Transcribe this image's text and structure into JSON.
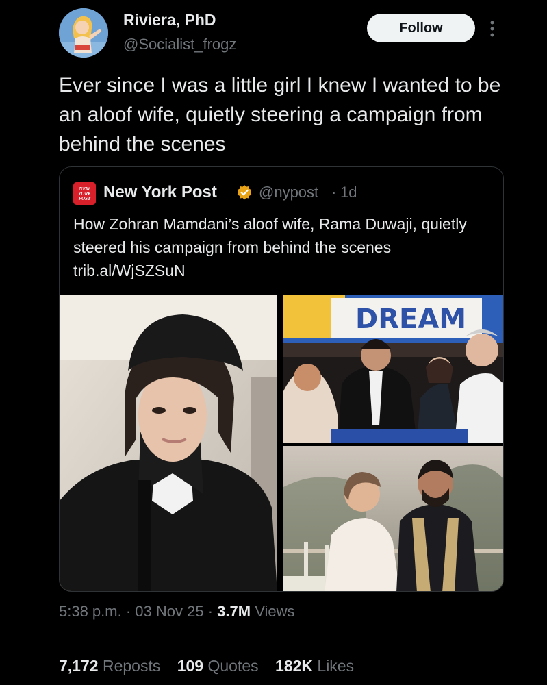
{
  "author": {
    "name": "Riviera, PhD",
    "handle": "@Socialist_frogz",
    "avatar_icon": "cartoon-woman-avatar"
  },
  "follow_label": "Follow",
  "more_icon": "vertical-ellipsis-icon",
  "tweet_text": "Ever since I was a little girl I knew I wanted to be an aloof wife, quietly steering a campaign from behind the scenes",
  "quoted": {
    "logo_text": "NEW YORK POST",
    "logo_icon": "new-york-post-logo",
    "name": "New York Post",
    "verified_icon": "gold-verified-badge",
    "handle": "@nypost",
    "separator": "·",
    "time": "1d",
    "text": "How Zohran Mamdani’s aloof wife, Rama Duwaji, quietly steered his campaign from behind the scenes trib.al/WjSZSuN",
    "photo_banner_text": "DREAM",
    "photos": [
      "selfie-portrait-photo",
      "campaign-stage-photo",
      "wedding-photo"
    ]
  },
  "meta": {
    "time": "5:38 p.m.",
    "sep1": "·",
    "date": "03 Nov 25",
    "sep2": "·",
    "views_count": "3.7M",
    "views_label": "Views"
  },
  "stats": {
    "reposts_count": "7,172",
    "reposts_label": "Reposts",
    "quotes_count": "109",
    "quotes_label": "Quotes",
    "likes_count": "182K",
    "likes_label": "Likes"
  },
  "colors": {
    "background": "#000000",
    "text": "#e7e9ea",
    "muted": "#71767b",
    "border": "#2f3336",
    "follow_bg": "#eff3f4",
    "verified": "#e8a317",
    "nypost_red": "#d8202b"
  }
}
